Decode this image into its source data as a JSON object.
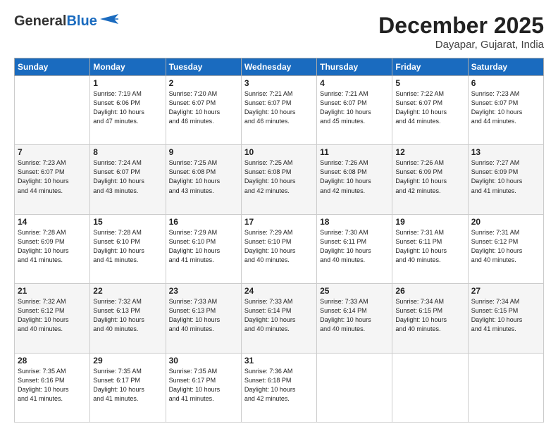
{
  "header": {
    "logo_general": "General",
    "logo_blue": "Blue",
    "month_year": "December 2025",
    "location": "Dayapar, Gujarat, India"
  },
  "days_of_week": [
    "Sunday",
    "Monday",
    "Tuesday",
    "Wednesday",
    "Thursday",
    "Friday",
    "Saturday"
  ],
  "weeks": [
    [
      {
        "day": "",
        "info": ""
      },
      {
        "day": "1",
        "info": "Sunrise: 7:19 AM\nSunset: 6:06 PM\nDaylight: 10 hours\nand 47 minutes."
      },
      {
        "day": "2",
        "info": "Sunrise: 7:20 AM\nSunset: 6:07 PM\nDaylight: 10 hours\nand 46 minutes."
      },
      {
        "day": "3",
        "info": "Sunrise: 7:21 AM\nSunset: 6:07 PM\nDaylight: 10 hours\nand 46 minutes."
      },
      {
        "day": "4",
        "info": "Sunrise: 7:21 AM\nSunset: 6:07 PM\nDaylight: 10 hours\nand 45 minutes."
      },
      {
        "day": "5",
        "info": "Sunrise: 7:22 AM\nSunset: 6:07 PM\nDaylight: 10 hours\nand 44 minutes."
      },
      {
        "day": "6",
        "info": "Sunrise: 7:23 AM\nSunset: 6:07 PM\nDaylight: 10 hours\nand 44 minutes."
      }
    ],
    [
      {
        "day": "7",
        "info": "Sunrise: 7:23 AM\nSunset: 6:07 PM\nDaylight: 10 hours\nand 44 minutes."
      },
      {
        "day": "8",
        "info": "Sunrise: 7:24 AM\nSunset: 6:07 PM\nDaylight: 10 hours\nand 43 minutes."
      },
      {
        "day": "9",
        "info": "Sunrise: 7:25 AM\nSunset: 6:08 PM\nDaylight: 10 hours\nand 43 minutes."
      },
      {
        "day": "10",
        "info": "Sunrise: 7:25 AM\nSunset: 6:08 PM\nDaylight: 10 hours\nand 42 minutes."
      },
      {
        "day": "11",
        "info": "Sunrise: 7:26 AM\nSunset: 6:08 PM\nDaylight: 10 hours\nand 42 minutes."
      },
      {
        "day": "12",
        "info": "Sunrise: 7:26 AM\nSunset: 6:09 PM\nDaylight: 10 hours\nand 42 minutes."
      },
      {
        "day": "13",
        "info": "Sunrise: 7:27 AM\nSunset: 6:09 PM\nDaylight: 10 hours\nand 41 minutes."
      }
    ],
    [
      {
        "day": "14",
        "info": "Sunrise: 7:28 AM\nSunset: 6:09 PM\nDaylight: 10 hours\nand 41 minutes."
      },
      {
        "day": "15",
        "info": "Sunrise: 7:28 AM\nSunset: 6:10 PM\nDaylight: 10 hours\nand 41 minutes."
      },
      {
        "day": "16",
        "info": "Sunrise: 7:29 AM\nSunset: 6:10 PM\nDaylight: 10 hours\nand 41 minutes."
      },
      {
        "day": "17",
        "info": "Sunrise: 7:29 AM\nSunset: 6:10 PM\nDaylight: 10 hours\nand 40 minutes."
      },
      {
        "day": "18",
        "info": "Sunrise: 7:30 AM\nSunset: 6:11 PM\nDaylight: 10 hours\nand 40 minutes."
      },
      {
        "day": "19",
        "info": "Sunrise: 7:31 AM\nSunset: 6:11 PM\nDaylight: 10 hours\nand 40 minutes."
      },
      {
        "day": "20",
        "info": "Sunrise: 7:31 AM\nSunset: 6:12 PM\nDaylight: 10 hours\nand 40 minutes."
      }
    ],
    [
      {
        "day": "21",
        "info": "Sunrise: 7:32 AM\nSunset: 6:12 PM\nDaylight: 10 hours\nand 40 minutes."
      },
      {
        "day": "22",
        "info": "Sunrise: 7:32 AM\nSunset: 6:13 PM\nDaylight: 10 hours\nand 40 minutes."
      },
      {
        "day": "23",
        "info": "Sunrise: 7:33 AM\nSunset: 6:13 PM\nDaylight: 10 hours\nand 40 minutes."
      },
      {
        "day": "24",
        "info": "Sunrise: 7:33 AM\nSunset: 6:14 PM\nDaylight: 10 hours\nand 40 minutes."
      },
      {
        "day": "25",
        "info": "Sunrise: 7:33 AM\nSunset: 6:14 PM\nDaylight: 10 hours\nand 40 minutes."
      },
      {
        "day": "26",
        "info": "Sunrise: 7:34 AM\nSunset: 6:15 PM\nDaylight: 10 hours\nand 40 minutes."
      },
      {
        "day": "27",
        "info": "Sunrise: 7:34 AM\nSunset: 6:15 PM\nDaylight: 10 hours\nand 41 minutes."
      }
    ],
    [
      {
        "day": "28",
        "info": "Sunrise: 7:35 AM\nSunset: 6:16 PM\nDaylight: 10 hours\nand 41 minutes."
      },
      {
        "day": "29",
        "info": "Sunrise: 7:35 AM\nSunset: 6:17 PM\nDaylight: 10 hours\nand 41 minutes."
      },
      {
        "day": "30",
        "info": "Sunrise: 7:35 AM\nSunset: 6:17 PM\nDaylight: 10 hours\nand 41 minutes."
      },
      {
        "day": "31",
        "info": "Sunrise: 7:36 AM\nSunset: 6:18 PM\nDaylight: 10 hours\nand 42 minutes."
      },
      {
        "day": "",
        "info": ""
      },
      {
        "day": "",
        "info": ""
      },
      {
        "day": "",
        "info": ""
      }
    ]
  ]
}
